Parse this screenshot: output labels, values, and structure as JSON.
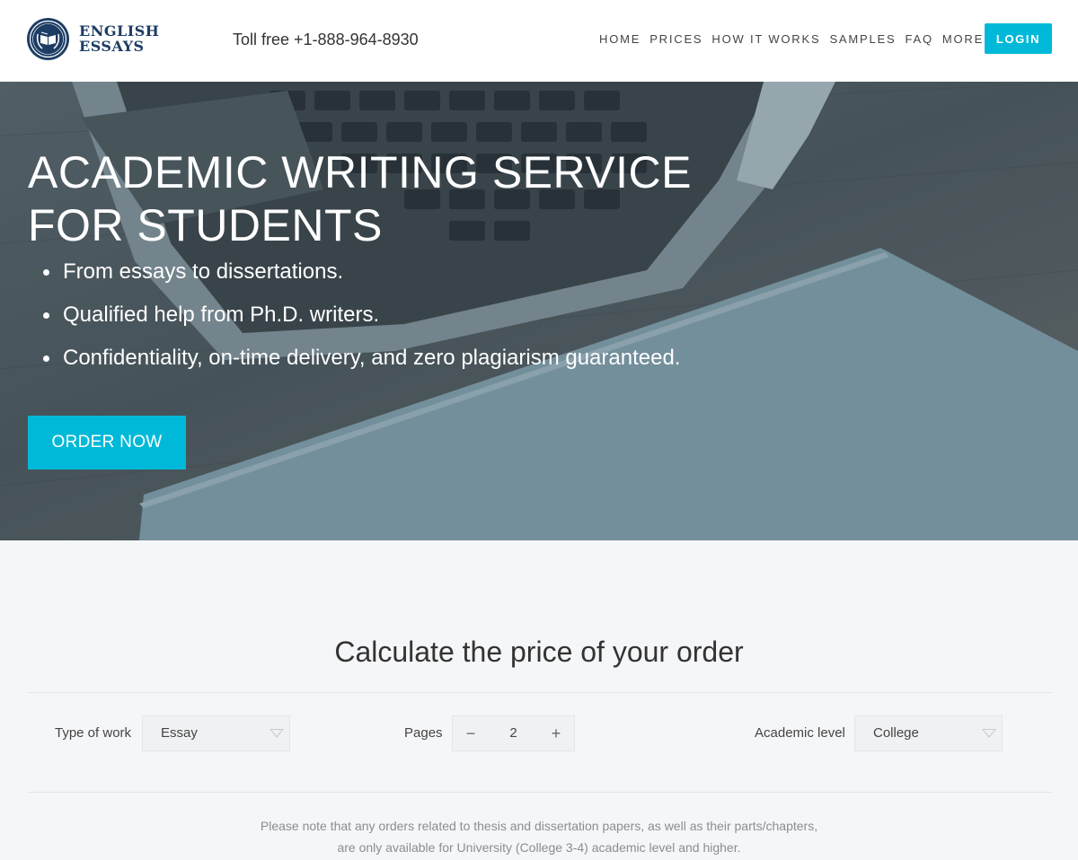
{
  "brand": {
    "name_line1": "ENGLISH",
    "name_line2": "ESSAYS"
  },
  "header": {
    "phone": "Toll free +1-888-964-8930",
    "nav": [
      {
        "label": "HOME"
      },
      {
        "label": "PRICES"
      },
      {
        "label": "HOW IT WORKS"
      },
      {
        "label": "SAMPLES"
      },
      {
        "label": "FAQ"
      },
      {
        "label": "MORE"
      }
    ],
    "login_label": "LOGIN"
  },
  "hero": {
    "title_line1": "ACADEMIC WRITING SERVICE",
    "title_line2": "FOR STUDENTS",
    "bullets": [
      "From essays to dissertations.",
      "Qualified help from Ph.D. writers.",
      "Confidentiality, on-time delivery, and zero plagiarism guaranteed."
    ],
    "cta_label": "ORDER NOW"
  },
  "calculator": {
    "title": "Calculate the price of your order",
    "type_of_work": {
      "label": "Type of work",
      "value": "Essay"
    },
    "pages": {
      "label": "Pages",
      "value": "2",
      "minus": "−",
      "plus": "+"
    },
    "academic_level": {
      "label": "Academic level",
      "value": "College"
    },
    "note_line1": "Please note that any orders related to thesis and dissertation papers, as well as their parts/chapters,",
    "note_line2": "are only available for University (College 3-4) academic level and higher."
  },
  "colors": {
    "accent": "#00b9d8",
    "brand_navy": "#1d3d64"
  },
  "icons": {
    "logo": "open-book-laurel-icon",
    "more_dropdown": "caret-down-icon",
    "select_arrow": "triangle-down-icon"
  }
}
